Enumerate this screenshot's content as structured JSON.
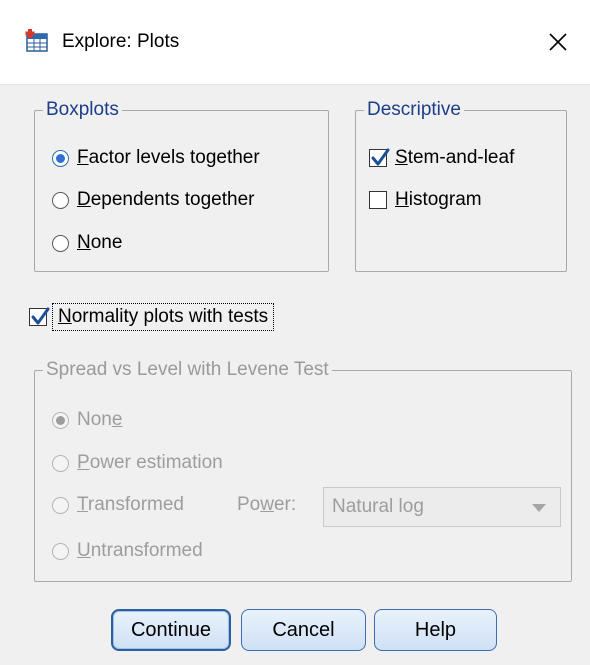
{
  "window": {
    "title": "Explore: Plots",
    "app_icon": "spss-table-icon",
    "close_glyph": "×"
  },
  "boxplots": {
    "label": "Boxplots",
    "options": [
      {
        "pre": "",
        "ul": "F",
        "post": "actor levels together",
        "checked": true
      },
      {
        "pre": "",
        "ul": "D",
        "post": "ependents together",
        "checked": false
      },
      {
        "pre": "",
        "ul": "N",
        "post": "one",
        "checked": false
      }
    ]
  },
  "descriptive": {
    "label": "Descriptive",
    "options": [
      {
        "pre": "",
        "ul": "S",
        "post": "tem-and-leaf",
        "checked": true
      },
      {
        "pre": "",
        "ul": "H",
        "post": "istogram",
        "checked": false
      }
    ]
  },
  "normality": {
    "pre": "",
    "ul": "N",
    "post": "ormality plots with tests",
    "checked": true
  },
  "spread": {
    "label": "Spread vs Level with Levene Test",
    "enabled": false,
    "options": [
      {
        "pre": "Non",
        "ul": "e",
        "post": "",
        "checked": true
      },
      {
        "pre": "",
        "ul": "P",
        "post": "ower estimation",
        "checked": false
      },
      {
        "pre": "",
        "ul": "T",
        "post": "ransformed",
        "checked": false
      },
      {
        "pre": "",
        "ul": "U",
        "post": "ntransformed",
        "checked": false
      }
    ],
    "power_label": {
      "pre": "Po",
      "ul": "w",
      "post": "er:"
    },
    "power_value": "Natural log"
  },
  "buttons": {
    "continue": "Continue",
    "cancel": "Cancel",
    "help": "Help"
  },
  "colors": {
    "group_label": "#1c3e88",
    "button_border": "#3b6db1",
    "disabled_text": "#9d9d9d"
  }
}
